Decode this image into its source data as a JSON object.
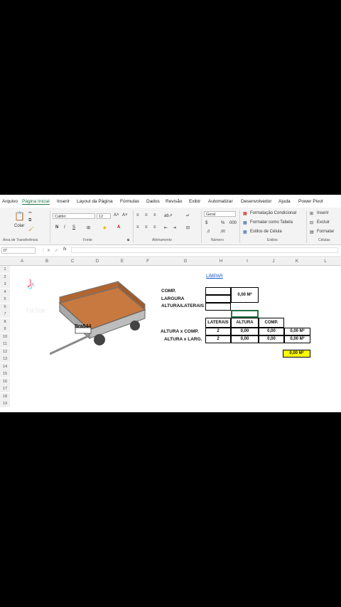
{
  "menubar": {
    "tabs": [
      "Arquivo",
      "Página Inicial",
      "Inserir",
      "Layout da Página",
      "Fórmulas",
      "Dados",
      "Revisão",
      "Exibir",
      "Automatizar",
      "Desenvolvedor",
      "Ajuda",
      "Power Pivot"
    ]
  },
  "ribbon": {
    "paste_label": "Colar",
    "font_name": "Calibri",
    "font_size": "12",
    "number_format": "Geral",
    "styles": [
      "Formatação Condicional",
      "Formatar como Tabela",
      "Estilos de Célula"
    ],
    "cells": [
      "Inserir",
      "Excluir",
      "Formatar"
    ],
    "groups": [
      "Área de Transferência",
      "Fonte",
      "Alinhamento",
      "Número",
      "Estilos",
      "Células"
    ]
  },
  "formula_bar": {
    "name_box": "I7",
    "fx": "fx",
    "content": ""
  },
  "columns": [
    "A",
    "B",
    "C",
    "D",
    "E",
    "F",
    "G",
    "H",
    "I",
    "J",
    "K",
    "L"
  ],
  "rows": [
    "1",
    "2",
    "3",
    "4",
    "5",
    "6",
    "7",
    "8",
    "9",
    "10",
    "11",
    "12",
    "13",
    "14",
    "15",
    "16",
    "17",
    "18",
    "19"
  ],
  "sheet": {
    "link": "LIMPAR",
    "labels": {
      "comp": "COMP.",
      "largura": "LARGURA",
      "altura": "ALTURA/LATERAIS"
    },
    "area_top": "0,00 M²",
    "table_headers": [
      "LATERAIS",
      "ALTURA",
      "COMP."
    ],
    "rows": [
      {
        "label": "ALTURA x COMP.",
        "laterais": "2",
        "altura": "0,00",
        "comp": "0,00",
        "result": "0,00 M²"
      },
      {
        "label": "ALTURA x LARG.",
        "laterais": "2",
        "altura": "0,00",
        "comp": "0,00",
        "result": "0,00 M²"
      }
    ],
    "total": "0,00 M²"
  },
  "image": {
    "plate": "Bra544",
    "watermark": "TikTok"
  }
}
